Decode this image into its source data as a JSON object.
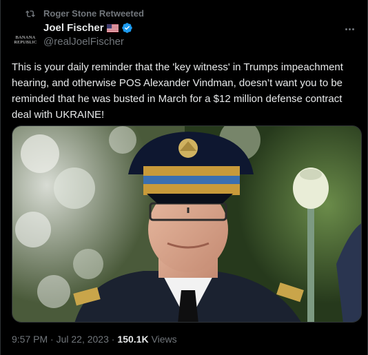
{
  "retweet": {
    "label": "Roger Stone Retweeted"
  },
  "author": {
    "avatar_text_line1": "BANANA",
    "avatar_text_line2": "REPUBLIC",
    "display_name": "Joel Fischer",
    "handle": "@realJoelFischer",
    "verified": true,
    "flag_icon": "us-flag-icon"
  },
  "tweet": {
    "text": "This is your daily reminder that the 'key witness' in Trumps impeachment hearing, and otherwise POS Alexander Vindman, doesn’t want you to be reminded that he was busted in March for a $12 million defense contract deal with UKRAINE!",
    "time": "9:57 PM · Jul 22, 2023 · ",
    "views_count": "150.1K",
    "views_label": "Views"
  },
  "colors": {
    "background": "#000000",
    "text_primary": "#e7e9ea",
    "text_secondary": "#71767b",
    "verified_blue": "#1d9bf0",
    "border": "#2f3336"
  }
}
